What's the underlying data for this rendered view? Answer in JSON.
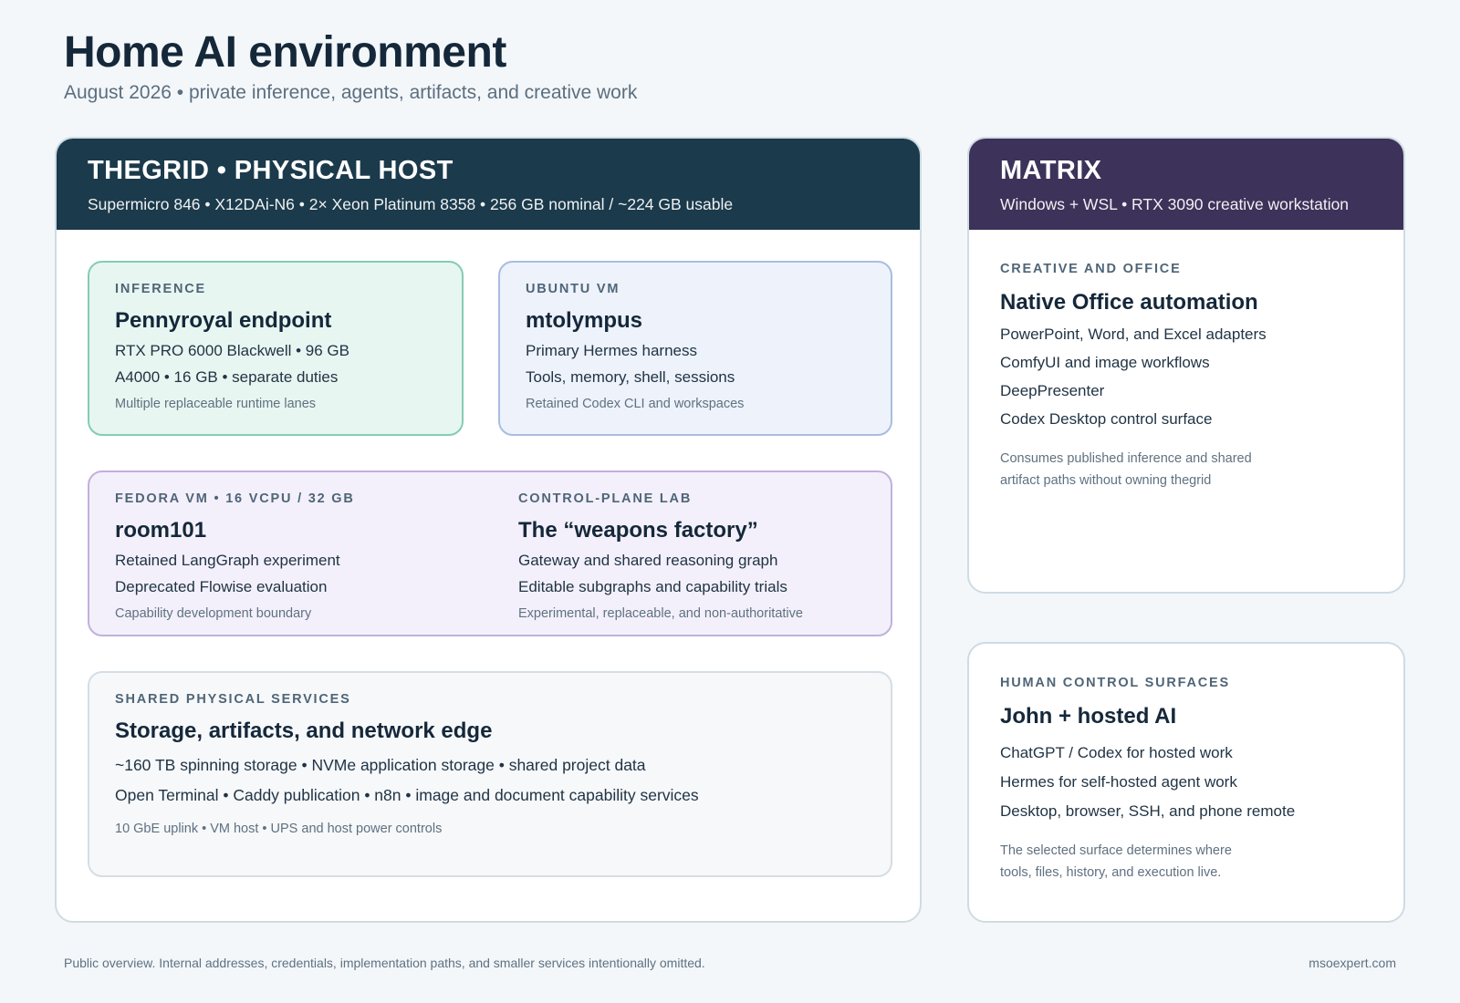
{
  "header": {
    "title": "Home AI environment",
    "subtitle": "August 2026 • private inference, agents, artifacts, and creative work"
  },
  "thegrid": {
    "title": "THEGRID • PHYSICAL HOST",
    "subtitle": "Supermicro 846 • X12DAi-N6 • 2× Xeon Platinum 8358 • 256 GB nominal / ~224 GB usable",
    "color": "#1b3a4b",
    "inference": {
      "label": "INFERENCE",
      "heading": "Pennyroyal endpoint",
      "lines": [
        "RTX PRO 6000 Blackwell • 96 GB",
        "A4000 • 16 GB • separate duties"
      ],
      "note": "Multiple replaceable runtime lanes"
    },
    "ubuntu": {
      "label": "UBUNTU VM",
      "heading": "mtolympus",
      "lines": [
        "Primary Hermes harness",
        "Tools, memory, shell, sessions"
      ],
      "note": "Retained Codex CLI and workspaces"
    },
    "fedora": {
      "label": "FEDORA VM • 16 vCPU / 32 GB",
      "heading": "room101",
      "lines": [
        "Retained LangGraph experiment",
        "Deprecated Flowise evaluation"
      ],
      "note": "Capability development boundary"
    },
    "lab": {
      "label": "CONTROL-PLANE LAB",
      "heading": "The “weapons factory”",
      "lines": [
        "Gateway and shared reasoning graph",
        "Editable subgraphs and capability trials"
      ],
      "note": "Experimental, replaceable, and non-authoritative"
    },
    "shared": {
      "label": "SHARED PHYSICAL SERVICES",
      "heading": "Storage, artifacts, and network edge",
      "lines": [
        "~160 TB spinning storage • NVMe application storage • shared project data",
        "Open Terminal • Caddy publication • n8n • image and document capability services"
      ],
      "note": "10 GbE uplink • VM host • UPS and host power controls"
    }
  },
  "matrix": {
    "title": "MATRIX",
    "subtitle": "Windows + WSL • RTX 3090 creative workstation",
    "color": "#3d3259",
    "label": "CREATIVE AND OFFICE",
    "heading": "Native Office automation",
    "lines": [
      "PowerPoint, Word, and Excel adapters",
      "ComfyUI and image workflows",
      "DeepPresenter",
      "Codex Desktop control surface"
    ],
    "note_lines": [
      "Consumes published inference and shared",
      "artifact paths without owning thegrid"
    ]
  },
  "human": {
    "label": "HUMAN CONTROL SURFACES",
    "heading": "John + hosted AI",
    "lines": [
      "ChatGPT / Codex for hosted work",
      "Hermes for self-hosted agent work",
      "Desktop, browser, SSH, and phone remote"
    ],
    "note_lines": [
      "The selected surface determines where",
      "tools, files, history, and execution live."
    ]
  },
  "footer": {
    "left": "Public overview. Internal addresses, credentials, implementation paths, and smaller services intentionally omitted.",
    "right": "msoexpert.com"
  }
}
